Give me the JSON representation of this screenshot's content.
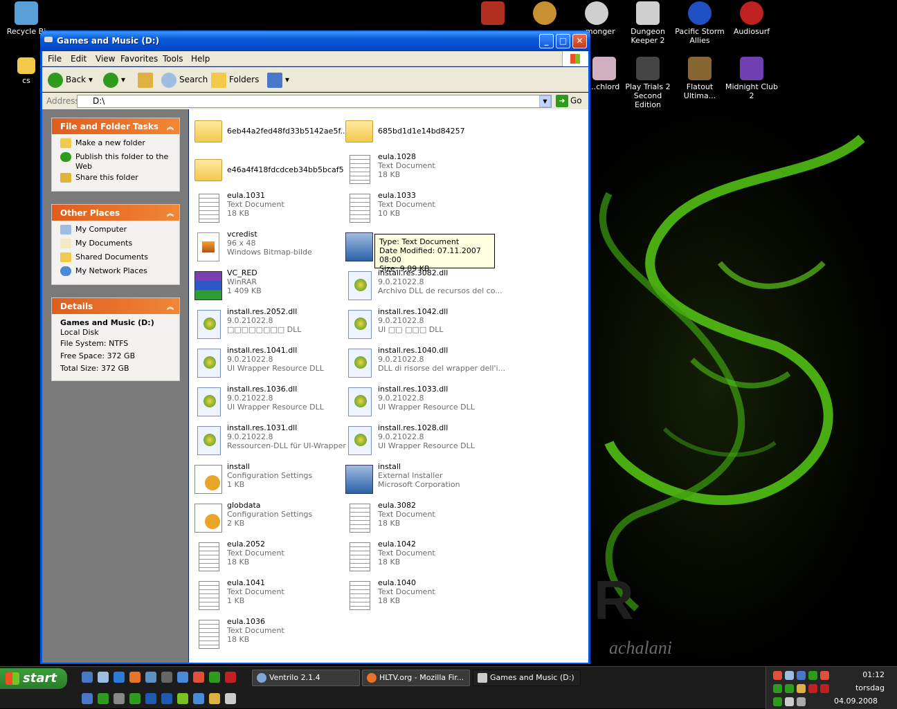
{
  "desktop": {
    "icons": [
      {
        "label": "Recycle Bi",
        "color": "#5aa0d8"
      },
      {
        "label": "cs",
        "color": "#f3c94c"
      },
      {
        "label": "",
        "color": "#b03020"
      },
      {
        "label": "",
        "color": "#c89030"
      },
      {
        "label": "...monger",
        "color": "#cfcfcf"
      },
      {
        "label": "Dungeon Keeper 2",
        "color": "#cfcfcf"
      },
      {
        "label": "Pacific Storm Allies",
        "color": "#2050c0"
      },
      {
        "label": "Audiosurf",
        "color": "#c02020"
      },
      {
        "label": "...chlord",
        "color": "#d0b0c0"
      },
      {
        "label": "Play Trials 2 Second Edition",
        "color": "#444444"
      },
      {
        "label": "Flatout Ultima...",
        "color": "#886633"
      },
      {
        "label": "Midnight Club 2",
        "color": "#7040b0"
      }
    ],
    "watermark": "achalani"
  },
  "window": {
    "title": "Games and Music (D:)",
    "menu": [
      "File",
      "Edit",
      "View",
      "Favorites",
      "Tools",
      "Help"
    ],
    "toolbar": {
      "back": "Back",
      "search": "Search",
      "folders": "Folders"
    },
    "address": {
      "label": "Address",
      "value": "D:\\",
      "go": "Go"
    }
  },
  "tasks": {
    "file_tasks": {
      "title": "File and Folder Tasks",
      "items": [
        "Make a new folder",
        "Publish this folder to the Web",
        "Share this folder"
      ]
    },
    "other_places": {
      "title": "Other Places",
      "items": [
        "My Computer",
        "My Documents",
        "Shared Documents",
        "My Network Places"
      ]
    },
    "details": {
      "title": "Details",
      "name": "Games and Music (D:)",
      "type": "Local Disk",
      "fs": "File System: NTFS",
      "free": "Free Space: 372 GB",
      "total": "Total Size: 372 GB"
    }
  },
  "files": [
    {
      "name": "6eb44a2fed48fd33b5142ae5f...",
      "l1": "",
      "l2": "",
      "icon": "folder"
    },
    {
      "name": "685bd1d1e14bd84257",
      "l1": "",
      "l2": "",
      "icon": "folder"
    },
    {
      "name": "e46a4f418fdcdceb34bb5bcaf5",
      "l1": "",
      "l2": "",
      "icon": "folder"
    },
    {
      "name": "eula.1028",
      "l1": "Text Document",
      "l2": "18 KB",
      "icon": "doc"
    },
    {
      "name": "eula.1031",
      "l1": "Text Document",
      "l2": "18 KB",
      "icon": "doc"
    },
    {
      "name": "eula.1033",
      "l1": "Text Document",
      "l2": "10 KB",
      "icon": "doc"
    },
    {
      "name": "vcredist",
      "l1": "96 x 48",
      "l2": "Windows Bitmap-bilde",
      "icon": "bmp"
    },
    {
      "name": "",
      "l1": "",
      "l2": "",
      "icon": "inst"
    },
    {
      "name": "VC_RED",
      "l1": "WinRAR",
      "l2": "1 409 KB",
      "icon": "rar"
    },
    {
      "name": "install.res.3082.dll",
      "l1": "9.0.21022.8",
      "l2": "Archivo DLL de recursos del co...",
      "icon": "dll"
    },
    {
      "name": "install.res.2052.dll",
      "l1": "9.0.21022.8",
      "l2": "□□□□□□□□ DLL",
      "icon": "dll"
    },
    {
      "name": "install.res.1042.dll",
      "l1": "9.0.21022.8",
      "l2": "UI □□ □□□ DLL",
      "icon": "dll"
    },
    {
      "name": "install.res.1041.dll",
      "l1": "9.0.21022.8",
      "l2": "UI Wrapper Resource DLL",
      "icon": "dll"
    },
    {
      "name": "install.res.1040.dll",
      "l1": "9.0.21022.8",
      "l2": "DLL di risorse del wrapper dell'i...",
      "icon": "dll"
    },
    {
      "name": "install.res.1036.dll",
      "l1": "9.0.21022.8",
      "l2": "UI Wrapper Resource DLL",
      "icon": "dll"
    },
    {
      "name": "install.res.1033.dll",
      "l1": "9.0.21022.8",
      "l2": "UI Wrapper Resource DLL",
      "icon": "dll"
    },
    {
      "name": "install.res.1031.dll",
      "l1": "9.0.21022.8",
      "l2": "Ressourcen-DLL für UI-Wrapper",
      "icon": "dll"
    },
    {
      "name": "install.res.1028.dll",
      "l1": "9.0.21022.8",
      "l2": "UI Wrapper Resource DLL",
      "icon": "dll"
    },
    {
      "name": "install",
      "l1": "Configuration Settings",
      "l2": "1 KB",
      "icon": "cfg"
    },
    {
      "name": "install",
      "l1": "External Installer",
      "l2": "Microsoft Corporation",
      "icon": "inst"
    },
    {
      "name": "globdata",
      "l1": "Configuration Settings",
      "l2": "2 KB",
      "icon": "cfg"
    },
    {
      "name": "eula.3082",
      "l1": "Text Document",
      "l2": "18 KB",
      "icon": "doc"
    },
    {
      "name": "eula.2052",
      "l1": "Text Document",
      "l2": "18 KB",
      "icon": "doc"
    },
    {
      "name": "eula.1042",
      "l1": "Text Document",
      "l2": "18 KB",
      "icon": "doc"
    },
    {
      "name": "eula.1041",
      "l1": "Text Document",
      "l2": "1 KB",
      "icon": "doc"
    },
    {
      "name": "eula.1040",
      "l1": "Text Document",
      "l2": "18 KB",
      "icon": "doc"
    },
    {
      "name": "eula.1036",
      "l1": "Text Document",
      "l2": "18 KB",
      "icon": "doc"
    }
  ],
  "tooltip": {
    "type": "Type: Text Document",
    "modified": "Date Modified: 07.11.2007 08:00",
    "size": "Size: 9,89 KB"
  },
  "taskbar": {
    "start": "start",
    "tasks": [
      {
        "label": "Ventrilo 2.1.4",
        "color": "#7fa8d8"
      },
      {
        "label": "HLTV.org - Mozilla Fir...",
        "color": "#e8742a"
      },
      {
        "label": "Games and Music (D:)",
        "color": "#cccccc"
      }
    ],
    "clock": {
      "time": "01:12",
      "day": "torsdag",
      "date": "04.09.2008"
    }
  }
}
